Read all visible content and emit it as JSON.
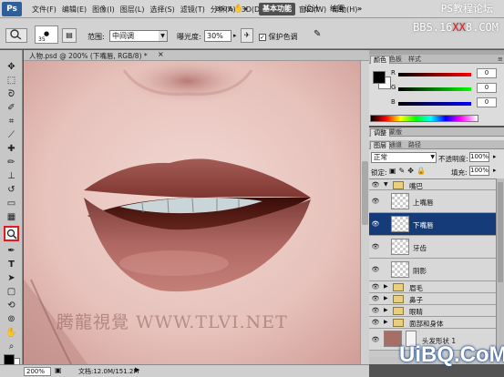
{
  "app": {
    "logo": "Ps"
  },
  "menu": [
    "文件(F)",
    "编辑(E)",
    "图像(I)",
    "图层(L)",
    "选择(S)",
    "滤镜(T)",
    "分析(A)",
    "3D(D)",
    "视图(V)",
    "窗口(W)",
    "帮助(H)"
  ],
  "app_controls": {
    "zoom": "200%",
    "arrange": "▾"
  },
  "workspaces": {
    "basic": "基本功能",
    "design": "设计",
    "paint": "绘画",
    "more": "»"
  },
  "watermarks": {
    "top": "PS教程论坛",
    "top2_prefix": "BBS.16",
    "top2_red": "XX",
    "top2_suffix": "8.COM",
    "canvas": "腾龍視覺 WWW.TLVI.NET",
    "corner": "UiBQ.CoM"
  },
  "options": {
    "brush_size": "35",
    "range_label": "范围:",
    "range_value": "中间调",
    "exposure_label": "曝光度:",
    "exposure_value": "30%",
    "protect_label": "保护色调",
    "protect_checked": "✓"
  },
  "document": {
    "tab_title": "人物.psd @ 200% (下嘴唇, RGB/8) *",
    "zoom": "200%",
    "info": "文档:12.0M/151.2M"
  },
  "color_panel": {
    "tabs": [
      "颜色",
      "色板",
      "样式"
    ],
    "channels": [
      {
        "label": "R",
        "value": "0",
        "gradient": "linear-gradient(to right,#000,#f00)"
      },
      {
        "label": "G",
        "value": "0",
        "gradient": "linear-gradient(to right,#000,#0f0)"
      },
      {
        "label": "B",
        "value": "0",
        "gradient": "linear-gradient(to right,#000,#00f)"
      }
    ]
  },
  "adjust_tabs": [
    "调整",
    "蒙版"
  ],
  "layers_tabs": [
    "图层",
    "通道",
    "路径"
  ],
  "layers": {
    "blend_mode": "正常",
    "opacity_label": "不透明度:",
    "opacity": "100%",
    "lock_label": "锁定:",
    "fill_label": "填充:",
    "fill": "100%",
    "items": [
      {
        "name": "嘴巴",
        "kind": "group-open",
        "selected": false
      },
      {
        "name": "上嘴唇",
        "kind": "layer",
        "selected": false
      },
      {
        "name": "下嘴唇",
        "kind": "layer",
        "selected": true
      },
      {
        "name": "牙齿",
        "kind": "layer",
        "selected": false
      },
      {
        "name": "阴影",
        "kind": "layer",
        "selected": false
      },
      {
        "name": "眉毛",
        "kind": "group",
        "selected": false
      },
      {
        "name": "鼻子",
        "kind": "group",
        "selected": false
      },
      {
        "name": "眼睛",
        "kind": "group",
        "selected": false
      },
      {
        "name": "面部和身体",
        "kind": "group",
        "selected": false
      },
      {
        "name": "头发形状 1",
        "kind": "shape",
        "selected": false
      }
    ]
  },
  "colors": {
    "accent_selected": "#153b78",
    "highlight_red": "#e01c1c"
  }
}
